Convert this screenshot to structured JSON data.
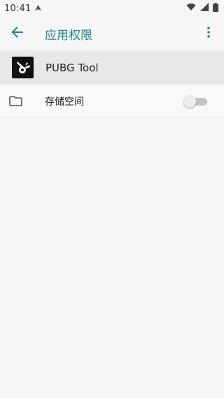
{
  "status_bar": {
    "time": "10:41"
  },
  "app_bar": {
    "title": "应用权限",
    "back_icon": "arrow-back-icon",
    "overflow_icon": "more-vert-icon",
    "accent_color": "#1b8a86"
  },
  "app": {
    "name": "PUBG Tool",
    "icon": "app-icon"
  },
  "permissions": [
    {
      "label": "存储空间",
      "icon": "folder-icon",
      "enabled": false
    }
  ]
}
